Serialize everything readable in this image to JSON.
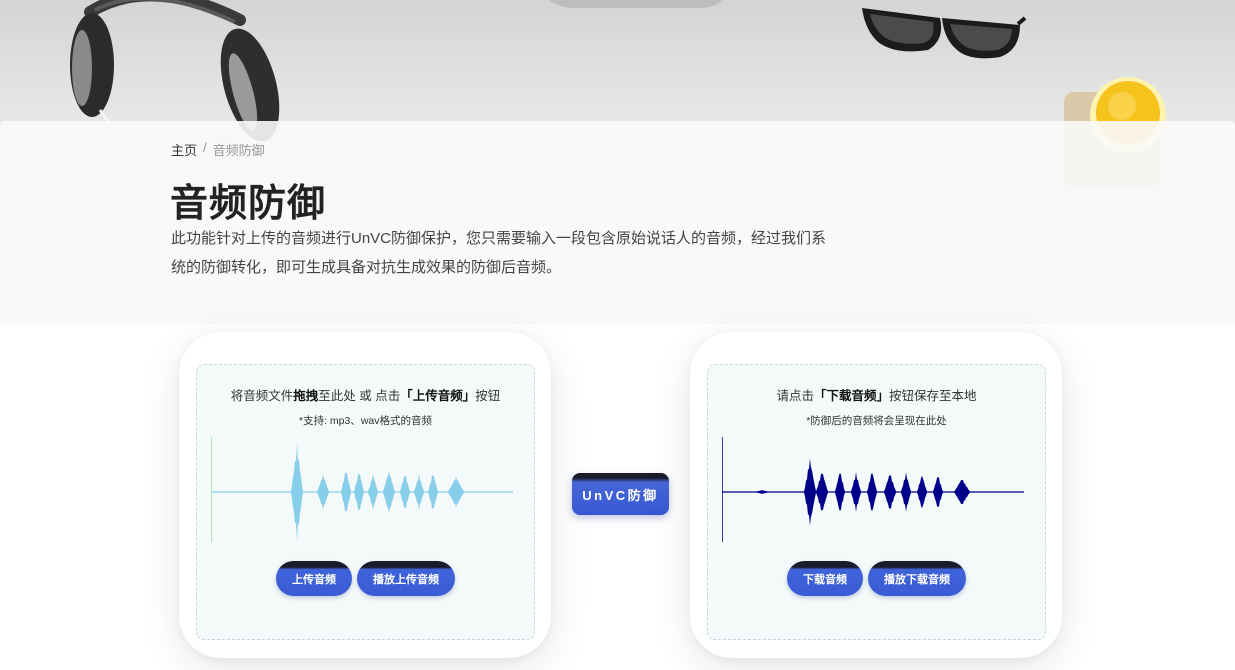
{
  "breadcrumb": {
    "home": "主页",
    "separator": "/",
    "current": "音频防御"
  },
  "page": {
    "title": "音频防御",
    "description": "此功能针对上传的音频进行UnVC防御保护，您只需要输入一段包含原始说话人的音频，经过我们系统的防御转化，即可生成具备对抗生成效果的防御后音频。"
  },
  "upload_card": {
    "title_pre": "将音频文件",
    "title_bold1": "拖拽",
    "title_mid": "至此处 或 点击",
    "title_bold2": "「上传音频」",
    "title_post": "按钮",
    "hint": "*支持: mp3、wav格式的音频",
    "upload_button": "上传音频",
    "play_button": "播放上传音频",
    "waveform_color": "#87ceeb",
    "cursor_color": "#90ee90"
  },
  "defend_button": "UnVC防御",
  "download_card": {
    "title_pre": "请点击",
    "title_bold": "「下载音频」",
    "title_post": "按钮保存至本地",
    "hint": "*防御后的音频将会呈现在此处",
    "download_button": "下载音频",
    "play_button": "播放下载音频",
    "waveform_color": "#00008b",
    "cursor_color": "#00008b"
  },
  "colors": {
    "accent": "#3a5bd4",
    "title": "#222222",
    "dropzone_bg": "#f4f9f9"
  },
  "icons": [
    "headphones-image",
    "glasses-image",
    "juice-glass-image"
  ]
}
